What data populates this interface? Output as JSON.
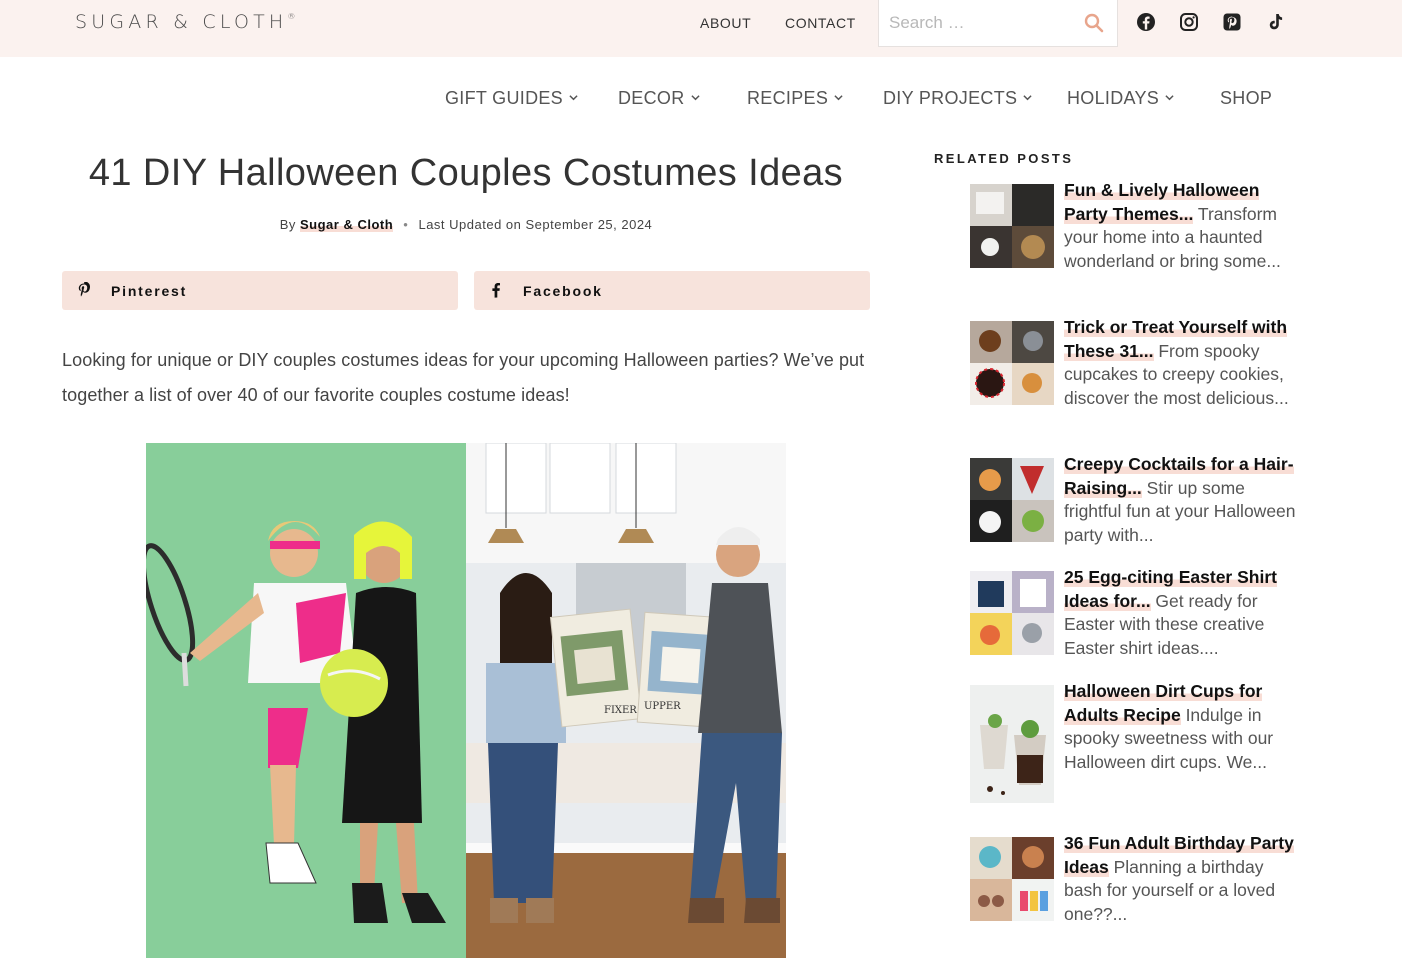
{
  "header": {
    "logo": "SUGAR & CLOTH",
    "logo_mark": "®",
    "links": [
      "ABOUT",
      "CONTACT"
    ],
    "search_placeholder": "Search …",
    "social": [
      "facebook-icon",
      "instagram-icon",
      "pinterest-icon",
      "tiktok-icon"
    ]
  },
  "nav": {
    "items": [
      "GIFT GUIDES",
      "DECOR",
      "RECIPES",
      "DIY PROJECTS",
      "HOLIDAYS",
      "SHOP"
    ]
  },
  "article": {
    "title": "41 DIY Halloween Couples Costumes Ideas",
    "by": "By",
    "author": "Sugar & Cloth",
    "updated": "Last Updated on September 25, 2024",
    "share_pinterest": "Pinterest",
    "share_facebook": "Facebook",
    "intro": "Looking for unique or DIY couples costumes ideas for your upcoming Halloween parties? We’ve put together a list of over 40 of our favorite couples costume ideas!",
    "sign_left": "FIXER",
    "sign_right": "UPPER"
  },
  "sidebar": {
    "heading": "RELATED POSTS",
    "posts": [
      {
        "title": "Fun & Lively Halloween Party Themes...",
        "excerpt": " Transform your home into a haunted wonderland or bring some..."
      },
      {
        "title": "Trick or Treat Yourself with These 31...",
        "excerpt": " From spooky cupcakes to creepy cookies, discover the most delicious..."
      },
      {
        "title": "Creepy Cocktails for a Hair-Raising...",
        "excerpt": " Stir up some frightful fun at your Halloween party with..."
      },
      {
        "title": "25 Egg-citing Easter Shirt Ideas for...",
        "excerpt": " Get ready for Easter with these creative Easter shirt ideas...."
      },
      {
        "title": "Halloween Dirt Cups for Adults Recipe",
        "excerpt": " Indulge in spooky sweetness with our Halloween dirt cups. We..."
      },
      {
        "title": "36 Fun Adult Birthday Party Ideas",
        "excerpt": " Planning a birthday bash for yourself or a loved one??..."
      }
    ]
  }
}
